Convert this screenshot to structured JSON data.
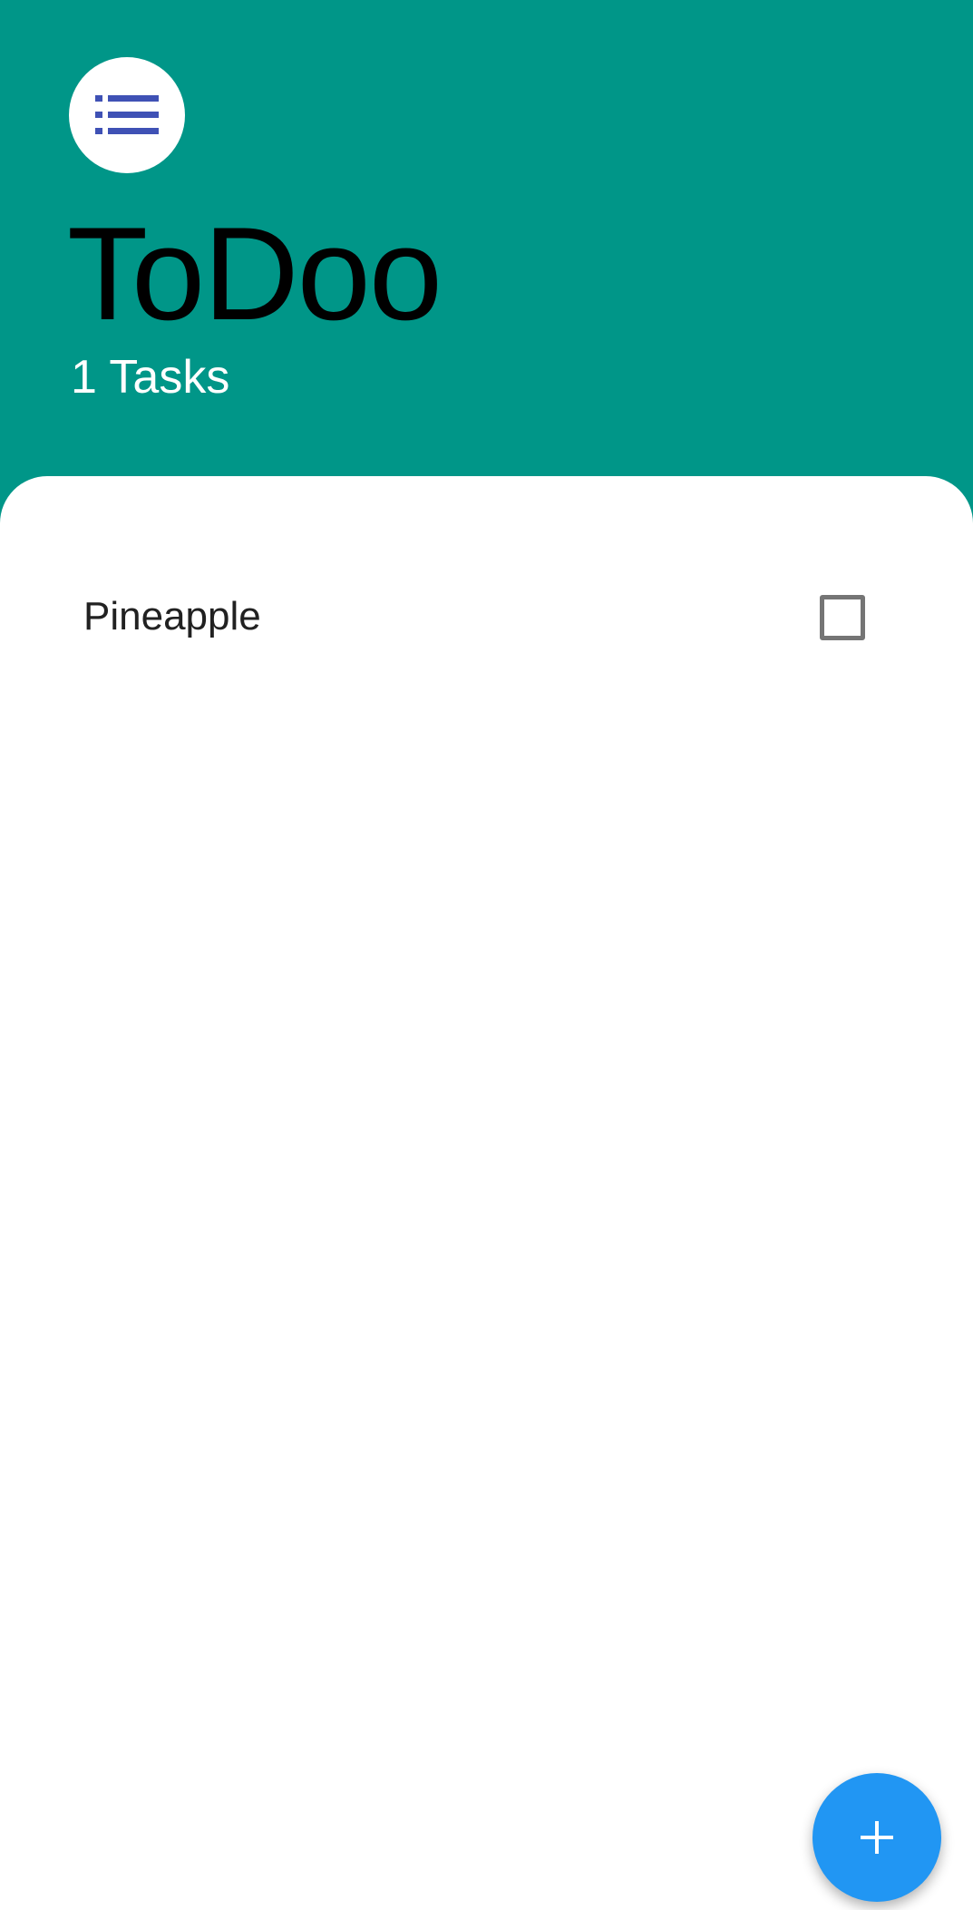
{
  "header": {
    "title": "ToDoo",
    "task_count": "1 Tasks",
    "menu_icon": "list-icon"
  },
  "tasks": [
    {
      "label": "Pineapple",
      "checked": false
    }
  ],
  "fab": {
    "icon": "plus-icon"
  },
  "colors": {
    "header_bg": "#009688",
    "sheet_bg": "#ffffff",
    "fab_bg": "#2196f3",
    "menu_icon": "#3f51b5",
    "checkbox_border": "#757575"
  }
}
